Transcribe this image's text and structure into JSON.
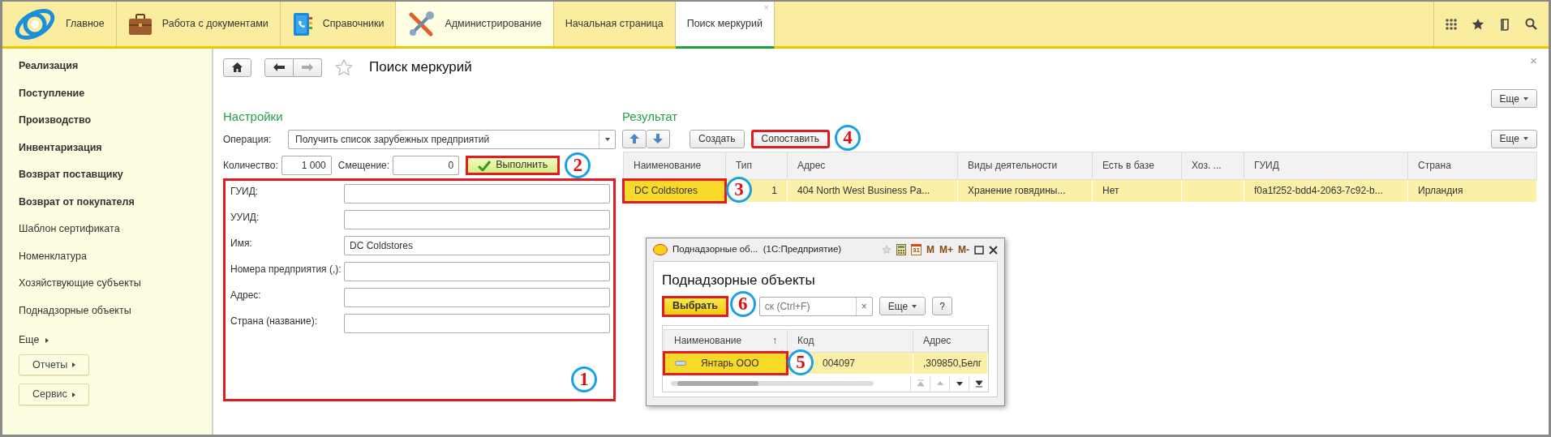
{
  "top_sections": [
    {
      "label": "Главное",
      "selected": false
    },
    {
      "label": "Работа с документами",
      "selected": false
    },
    {
      "label": "Справочники",
      "selected": false
    },
    {
      "label": "Администрирование",
      "selected": true
    }
  ],
  "open_tabs": [
    {
      "label": "Начальная страница",
      "selected": false
    },
    {
      "label": "Поиск меркурий",
      "selected": true,
      "close": "×"
    }
  ],
  "sidebar": {
    "items": [
      {
        "label": "Реализация",
        "bold": true
      },
      {
        "label": "Поступление",
        "bold": true
      },
      {
        "label": "Производство",
        "bold": true
      },
      {
        "label": "Инвентаризация",
        "bold": true
      },
      {
        "label": "Возврат поставщику",
        "bold": true
      },
      {
        "label": "Возврат от покупателя",
        "bold": true
      },
      {
        "label": "Шаблон сертификата",
        "bold": false
      },
      {
        "label": "Номенклатура",
        "bold": false
      },
      {
        "label": "Хозяйствующие субъекты",
        "bold": false
      },
      {
        "label": "Поднадзорные объекты",
        "bold": false
      }
    ],
    "more": "Еще",
    "buttons": [
      "Отчеты",
      "Сервис"
    ]
  },
  "form": {
    "title": "Поиск меркурий",
    "close": "×",
    "more": "Еще"
  },
  "settings": {
    "heading": "Настройки",
    "operation_label": "Операция:",
    "operation_value": "Получить список зарубежных предприятий",
    "quantity_label": "Количество:",
    "quantity_value": "1 000",
    "offset_label": "Смещение:",
    "offset_value": "0",
    "execute": {
      "label": "Выполнить",
      "framed": true,
      "callout": "2"
    },
    "filters": {
      "framed": true,
      "callout": "1",
      "fields": [
        {
          "label": "ГУИД:"
        },
        {
          "label": "УУИД:"
        },
        {
          "label": "Имя:",
          "value": "DC Coldstores"
        },
        {
          "label": "Номера предприятия (,):"
        },
        {
          "label": "Адрес:"
        },
        {
          "label": "Страна (название):"
        }
      ]
    }
  },
  "result": {
    "heading": "Результат",
    "create": "Создать",
    "match": {
      "label": "Сопоставить",
      "framed": true,
      "callout": "4"
    },
    "more": "Еще",
    "table": {
      "columns": [
        "Наименование",
        "Тип",
        "Адрес",
        "Виды деятельности",
        "Есть в базе",
        "Хоз. ...",
        "ГУИД",
        "Страна"
      ],
      "rows": [
        {
          "selected": true,
          "name_framed": true,
          "callout": "3",
          "cells": [
            "DC Coldstores",
            "1",
            "404 North West Business Pa...",
            "Хранение говядины...",
            "Нет",
            null,
            "f0a1f252-bdd4-2063-7c92-b...",
            "Ирландия"
          ]
        }
      ]
    }
  },
  "popup": {
    "title": "Поднадзорные об...  (1С:Предприятие)",
    "calendar": "31",
    "memory_buttons": [
      "M",
      "M+",
      "M-"
    ],
    "heading": "Поднадзорные объекты",
    "select": {
      "label": "Выбрать",
      "framed": true,
      "callout": "6"
    },
    "search_placeholder": "ск (Ctrl+F)",
    "search_clear": "×",
    "more": "Еще",
    "help": "?",
    "table": {
      "columns": [
        "Наименование",
        "Код",
        "Адрес"
      ],
      "sort_mark": "↑",
      "rows": [
        {
          "selected": true,
          "name_framed": true,
          "callout": "5",
          "cells": [
            "Янтарь ООО",
            "004097",
            ",309850,Белг"
          ]
        }
      ]
    }
  }
}
